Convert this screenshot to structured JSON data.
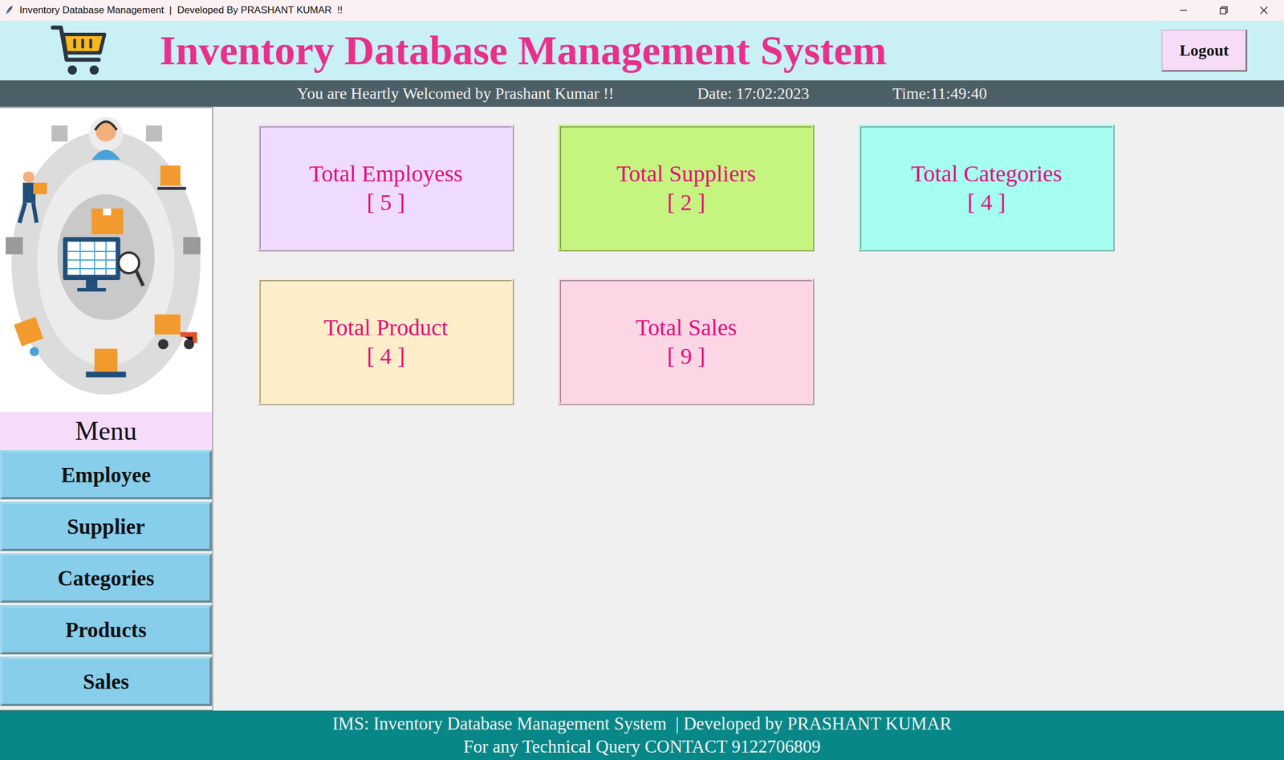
{
  "window": {
    "title": "Inventory Database Management  |  Developed By PRASHANT KUMAR  !!"
  },
  "header": {
    "title": "Inventory Database Management System",
    "logout": "Logout"
  },
  "welcome_bar": {
    "message": "You are Heartly Welcomed by Prashant Kumar !!",
    "date": "Date: 17:02:2023",
    "time": "Time:11:49:40"
  },
  "sidebar": {
    "menu_label": "Menu",
    "items": [
      "Employee",
      "Supplier",
      "Categories",
      "Products",
      "Sales"
    ]
  },
  "cards": [
    {
      "label": "Total Employess",
      "count": "[ 5 ]",
      "color": "#efdbfd"
    },
    {
      "label": "Total Suppliers",
      "count": "[ 2 ]",
      "color": "#c5f57f"
    },
    {
      "label": "Total Categories",
      "count": "[ 4 ]",
      "color": "#a6fef0"
    },
    {
      "label": "Total Product",
      "count": "[ 4 ]",
      "color": "#fdedc8"
    },
    {
      "label": "Total Sales",
      "count": "[ 9 ]",
      "color": "#fdd6e6"
    }
  ],
  "footer": {
    "lines": [
      "IMS: Inventory Database Management System  | Developed by PRASHANT KUMAR",
      "For any Technical Query CONTACT 9122706809"
    ]
  }
}
